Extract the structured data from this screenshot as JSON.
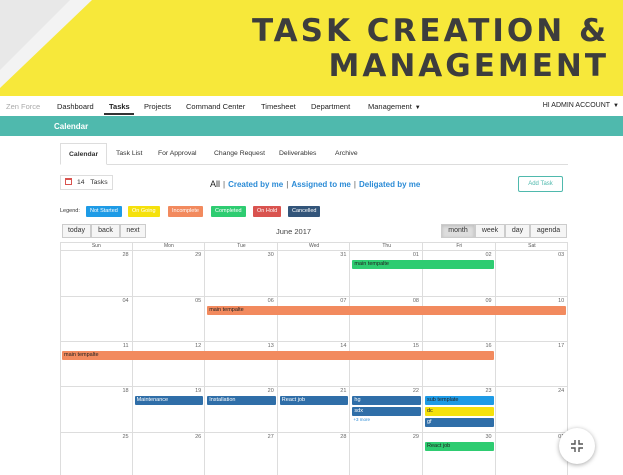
{
  "banner": {
    "line1": "TASK CREATION &",
    "line2": "MANAGEMENT"
  },
  "nav": {
    "brand": "Zen Force",
    "items": [
      {
        "label": "Dashboard",
        "active": false
      },
      {
        "label": "Tasks",
        "active": true
      },
      {
        "label": "Projects",
        "active": false
      },
      {
        "label": "Command Center",
        "active": false
      },
      {
        "label": "Timesheet",
        "active": false
      },
      {
        "label": "Department",
        "active": false
      },
      {
        "label": "Management",
        "active": false
      }
    ],
    "account": "HI ADMIN ACCOUNT"
  },
  "header": {
    "title": "Calendar"
  },
  "tabs": [
    "Calendar",
    "Task List",
    "For Approval",
    "Change Request",
    "Deliverables",
    "Archive"
  ],
  "tasks": {
    "count": "14",
    "label": "Tasks"
  },
  "filters": {
    "all": "All",
    "created": "Created by me",
    "assigned": "Assigned to me",
    "delegated": "Deligated by me"
  },
  "add_task": "Add Task",
  "legend": {
    "label": "Legend:",
    "items": [
      {
        "label": "Not Started",
        "color": "#1e9be6"
      },
      {
        "label": "On Going",
        "color": "#f5e10c"
      },
      {
        "label": "Incomplete",
        "color": "#f28a5e"
      },
      {
        "label": "Completed",
        "color": "#2ecc71"
      },
      {
        "label": "On Hold",
        "color": "#d9534f"
      },
      {
        "label": "Cancelled",
        "color": "#33557a"
      }
    ]
  },
  "toolbar": {
    "today": "today",
    "back": "back",
    "next": "next",
    "title": "June 2017",
    "views": [
      {
        "label": "month",
        "active": true
      },
      {
        "label": "week",
        "active": false
      },
      {
        "label": "day",
        "active": false
      },
      {
        "label": "agenda",
        "active": false
      }
    ]
  },
  "calendar": {
    "dow": [
      "Sun",
      "Mon",
      "Tue",
      "Wed",
      "Thu",
      "Fri",
      "Sat"
    ],
    "weeks": [
      [
        "28",
        "29",
        "30",
        "31",
        "01",
        "02",
        "03"
      ],
      [
        "04",
        "05",
        "06",
        "07",
        "08",
        "09",
        "10"
      ],
      [
        "11",
        "12",
        "13",
        "14",
        "15",
        "16",
        "17"
      ],
      [
        "18",
        "19",
        "20",
        "21",
        "22",
        "23",
        "24"
      ],
      [
        "25",
        "26",
        "27",
        "28",
        "29",
        "30",
        "01"
      ]
    ],
    "events": [
      {
        "label": "main tempalte",
        "week": 0,
        "start": 4,
        "span": 2,
        "slot": 0,
        "color": "#2ecc71"
      },
      {
        "label": "main tempalte",
        "week": 1,
        "start": 2,
        "span": 5,
        "slot": 0,
        "color": "#f28a5e"
      },
      {
        "label": "main tempalte",
        "week": 2,
        "start": 0,
        "span": 6,
        "slot": 0,
        "color": "#f28a5e"
      },
      {
        "label": "Maintenance",
        "week": 3,
        "start": 1,
        "span": 1,
        "slot": 0,
        "color": "#2f6ea8"
      },
      {
        "label": "Installation",
        "week": 3,
        "start": 2,
        "span": 1,
        "slot": 0,
        "color": "#2f6ea8"
      },
      {
        "label": "React job",
        "week": 3,
        "start": 3,
        "span": 1,
        "slot": 0,
        "color": "#2f6ea8"
      },
      {
        "label": "hg",
        "week": 3,
        "start": 4,
        "span": 1,
        "slot": 0,
        "color": "#2f6ea8"
      },
      {
        "label": "sdx",
        "week": 3,
        "start": 4,
        "span": 1,
        "slot": 1,
        "color": "#2f6ea8"
      },
      {
        "label": "sub template",
        "week": 3,
        "start": 5,
        "span": 1,
        "slot": 0,
        "color": "#1e9be6"
      },
      {
        "label": "dc",
        "week": 3,
        "start": 5,
        "span": 1,
        "slot": 1,
        "color": "#f5e10c"
      },
      {
        "label": "gf",
        "week": 3,
        "start": 5,
        "span": 1,
        "slot": 2,
        "color": "#2f6ea8"
      },
      {
        "label": "React job",
        "week": 4,
        "start": 5,
        "span": 1,
        "slot": 0,
        "color": "#2ecc71"
      }
    ],
    "more": {
      "label": "+3 more",
      "week": 3,
      "day": 4
    }
  },
  "fab": {
    "icon": "collapse-icon"
  }
}
